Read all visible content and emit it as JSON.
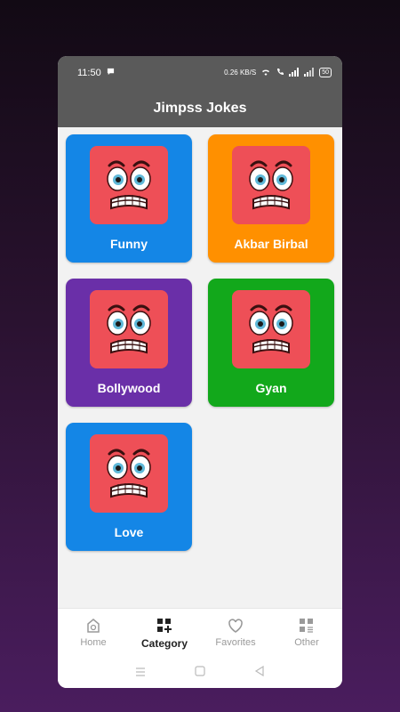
{
  "status": {
    "time": "11:50",
    "speed": "0.26 KB/S",
    "battery": "50"
  },
  "app": {
    "title": "Jimpss Jokes"
  },
  "categories": [
    {
      "label": "Funny",
      "color": "#1486e6"
    },
    {
      "label": "Akbar Birbal",
      "color": "#ff9000"
    },
    {
      "label": "Bollywood",
      "color": "#6a2fa8"
    },
    {
      "label": "Gyan",
      "color": "#12a81b"
    },
    {
      "label": "Love",
      "color": "#1486e6"
    }
  ],
  "nav": {
    "home": "Home",
    "category": "Category",
    "favorites": "Favorites",
    "other": "Other"
  }
}
